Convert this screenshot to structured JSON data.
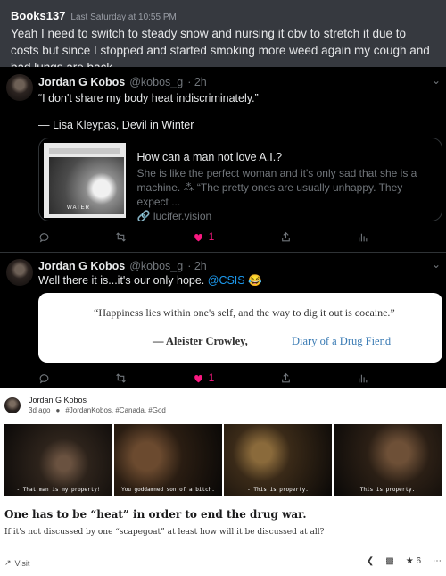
{
  "chat": {
    "user": "Books137",
    "time": "Last Saturday at 10:55 PM",
    "message": "Yeah I need to switch to steady snow and nursing it obv to stretch it due to costs but since I stopped and started smoking more weed again my cough and bad lungs are back."
  },
  "tweets": [
    {
      "name": "Jordan G Kobos",
      "handle": "@kobos_g",
      "age": "· 2h",
      "line1": "“I don't share my body heat indiscriminately.”",
      "line2": "— Lisa Kleypas, Devil in Winter",
      "card": {
        "thumb_label": "WATER",
        "title": "How can a man not love A.I.?",
        "desc1": "She is like the perfect woman and it's only sad that she is a",
        "desc2": "machine. ⁂ “The pretty ones are usually unhappy. They expect ...",
        "link": "lucifer.vision"
      },
      "likes": "1"
    },
    {
      "name": "Jordan G Kobos",
      "handle": "@kobos_g",
      "age": "· 2h",
      "text": "Well there it is...it's our only hope. ",
      "mention": "@CSIS",
      "emoji": "😂",
      "quote": {
        "text": "“Happiness lies within one's self, and the way to dig it out is cocaine.”",
        "author": "— Aleister Crowley,",
        "book": "Diary of a Drug Fiend"
      },
      "likes": "1"
    }
  ],
  "post": {
    "author": "Jordan G Kobos",
    "age": "3d ago",
    "tags": "#JordanKobos, #Canada, #God",
    "frames": [
      {
        "caption": "- That man is my property!"
      },
      {
        "caption": "You goddamned son of a bitch."
      },
      {
        "caption": "- This is property."
      },
      {
        "caption": "This is property."
      }
    ],
    "title": "One has to be “heat” in order to end the drug war.",
    "body": "If it's not discussed by one “scapegoat” at least how will it be discussed at all?",
    "visit": "Visit",
    "stars": "6"
  }
}
